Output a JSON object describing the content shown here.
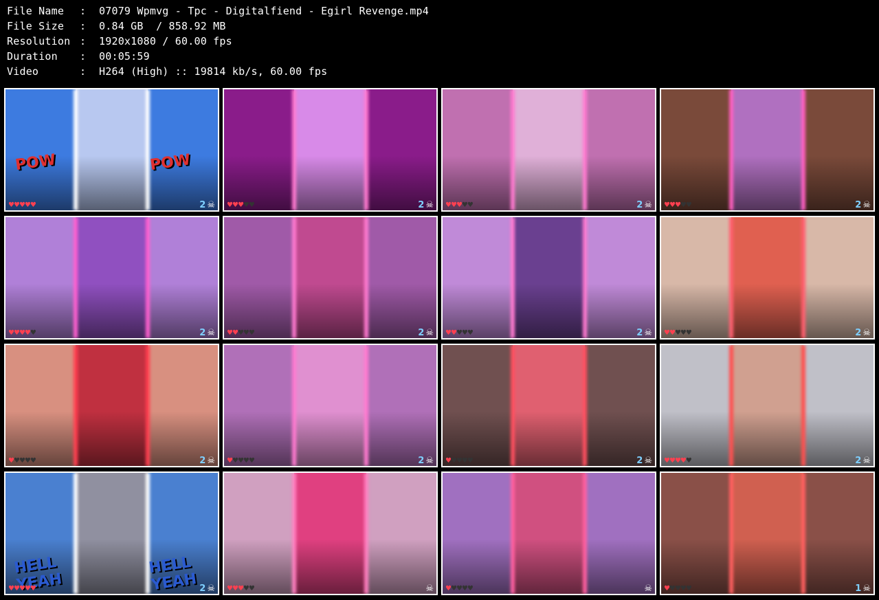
{
  "header": {
    "rows": [
      {
        "key": "File Name",
        "sep": ":",
        "value": "07079 Wpmvg - Tpc - Digitalfiend - Egirl Revenge.mp4"
      },
      {
        "key": "File Size",
        "sep": ":",
        "value": "0.84 GB  / 858.92 MB"
      },
      {
        "key": "Resolution",
        "sep": ":",
        "value": "1920x1080 / 60.00 fps"
      },
      {
        "key": "Duration",
        "sep": ":",
        "value": "00:05:59"
      },
      {
        "key": "Video",
        "sep": ":",
        "value": "H264 (High) :: 19814 kb/s, 60.00 fps"
      }
    ]
  },
  "thumbnails": [
    {
      "counter": "2",
      "hearts": 5,
      "filled": 5,
      "palette": [
        "#3d7be0",
        "#b8c8f0",
        "#3d7be0"
      ],
      "glow": "#ffffff",
      "text": "POW",
      "text_color": "#e03030"
    },
    {
      "counter": "2",
      "hearts": 5,
      "filled": 3,
      "palette": [
        "#8a1c8a",
        "#d88ae8",
        "#8a1c8a"
      ],
      "glow": "#ff7ad0",
      "text": "",
      "text_color": ""
    },
    {
      "counter": "2",
      "hearts": 5,
      "filled": 3,
      "palette": [
        "#c070b0",
        "#e0b0d8",
        "#c070b0"
      ],
      "glow": "#ff7ad0",
      "text": "",
      "text_color": ""
    },
    {
      "counter": "2",
      "hearts": 5,
      "filled": 3,
      "palette": [
        "#7a4a3a",
        "#b070c0",
        "#7a4a3a"
      ],
      "glow": "#ff60c0",
      "text": "",
      "text_color": ""
    },
    {
      "counter": "2",
      "hearts": 5,
      "filled": 4,
      "palette": [
        "#b080d8",
        "#9050c0",
        "#b080d8"
      ],
      "glow": "#ff60d0",
      "text": "",
      "text_color": ""
    },
    {
      "counter": "2",
      "hearts": 5,
      "filled": 2,
      "palette": [
        "#a05aa8",
        "#c04a90",
        "#a05aa8"
      ],
      "glow": "#ff7ad0",
      "text": "",
      "text_color": ""
    },
    {
      "counter": "2",
      "hearts": 5,
      "filled": 2,
      "palette": [
        "#c08ad8",
        "#6a4090",
        "#c08ad8"
      ],
      "glow": "#ff7ad0",
      "text": "",
      "text_color": ""
    },
    {
      "counter": "2",
      "hearts": 5,
      "filled": 2,
      "palette": [
        "#d8b8a8",
        "#e06050",
        "#d8b8a8"
      ],
      "glow": "#ff6070",
      "text": "",
      "text_color": ""
    },
    {
      "counter": "2",
      "hearts": 5,
      "filled": 1,
      "palette": [
        "#d89080",
        "#c03040",
        "#d89080"
      ],
      "glow": "#ff4050",
      "text": "",
      "text_color": ""
    },
    {
      "counter": "2",
      "hearts": 5,
      "filled": 1,
      "palette": [
        "#b070b8",
        "#e090d0",
        "#b070b8"
      ],
      "glow": "#ff7ad0",
      "text": "",
      "text_color": ""
    },
    {
      "counter": "2",
      "hearts": 5,
      "filled": 1,
      "palette": [
        "#705050",
        "#e06070",
        "#705050"
      ],
      "glow": "#ff5060",
      "text": "",
      "text_color": ""
    },
    {
      "counter": "2",
      "hearts": 5,
      "filled": 4,
      "palette": [
        "#c0c0c8",
        "#d0a090",
        "#c0c0c8"
      ],
      "glow": "#ff5050",
      "text": "",
      "text_color": ""
    },
    {
      "counter": "2",
      "hearts": 5,
      "filled": 5,
      "palette": [
        "#4a80d0",
        "#9090a0",
        "#4a80d0"
      ],
      "glow": "#ffffff",
      "text": "HELL YEAH",
      "text_color": "#2a5ad0"
    },
    {
      "counter": "",
      "hearts": 5,
      "filled": 3,
      "palette": [
        "#d0a0c0",
        "#e04080",
        "#d0a0c0"
      ],
      "glow": "#ff80c0",
      "text": "",
      "text_color": ""
    },
    {
      "counter": "",
      "hearts": 5,
      "filled": 1,
      "palette": [
        "#a070c0",
        "#d05080",
        "#a070c0"
      ],
      "glow": "#ff60a0",
      "text": "",
      "text_color": ""
    },
    {
      "counter": "1",
      "hearts": 5,
      "filled": 1,
      "palette": [
        "#8a5048",
        "#d06050",
        "#8a5048"
      ],
      "glow": "#ff6060",
      "text": "",
      "text_color": ""
    }
  ]
}
